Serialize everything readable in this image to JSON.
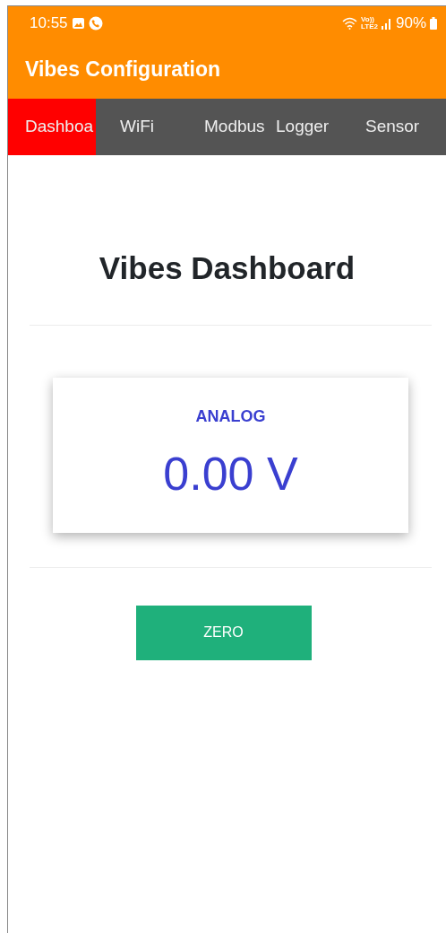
{
  "status_bar": {
    "time": "10:55",
    "network_label_top": "Vo))",
    "network_label_bottom": "LTE2",
    "battery_text": "90%"
  },
  "app_bar": {
    "title": "Vibes Configuration"
  },
  "tabs": [
    {
      "label": "Dashboa",
      "selected": true
    },
    {
      "label": "WiFi",
      "selected": false
    },
    {
      "label": "Modbus",
      "selected": false
    },
    {
      "label": "Logger",
      "selected": false
    },
    {
      "label": "Sensor",
      "selected": false
    }
  ],
  "heading": "Vibes Dashboard",
  "reading_card": {
    "label": "ANALOG",
    "value": "0.00 V"
  },
  "buttons": [
    {
      "label": "ZERO"
    }
  ]
}
